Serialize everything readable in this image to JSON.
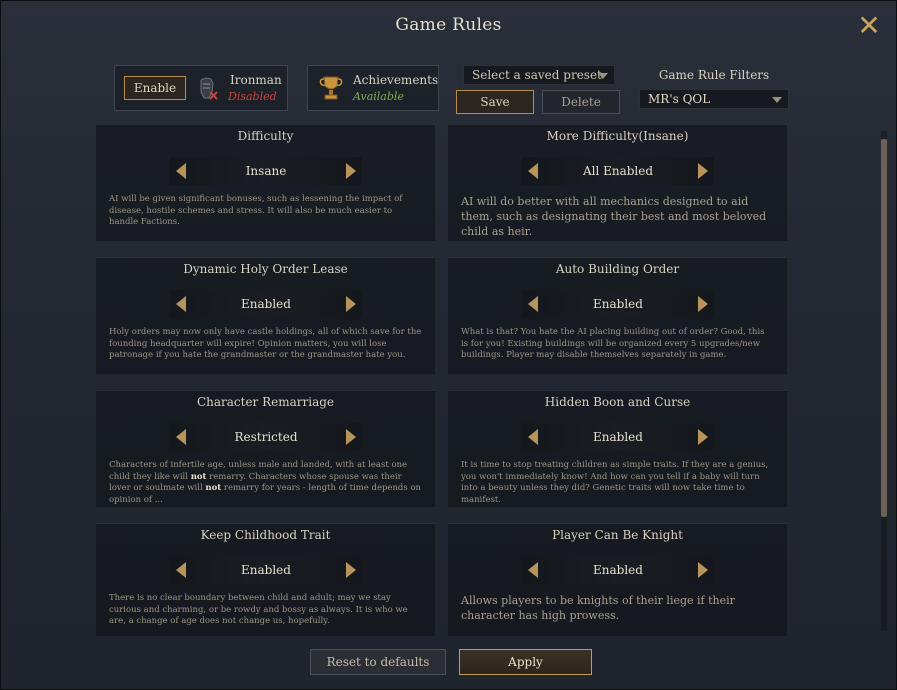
{
  "window": {
    "title": "Game Rules",
    "close_icon": "close-icon"
  },
  "ironman": {
    "enable_label": "Enable",
    "label": "Ironman",
    "status": "Disabled",
    "status_color": "#c9443a"
  },
  "achievements": {
    "label": "Achievements",
    "status": "Available",
    "status_color": "#7fae4f"
  },
  "preset": {
    "placeholder": "Select a saved preset",
    "save_label": "Save",
    "delete_label": "Delete"
  },
  "filters": {
    "title": "Game Rule Filters",
    "selected": "MR's QOL"
  },
  "rules": [
    {
      "title": "Difficulty",
      "value": "Insane",
      "desc": "AI will be given significant bonuses, such as lessening the impact of disease, hostile schemes and stress. It will also be much easier to handle Factions."
    },
    {
      "title": "More Difficulty(Insane)",
      "value": "All Enabled",
      "desc": "AI will do better with all mechanics designed to aid them, such as designating their best and most beloved child as heir."
    },
    {
      "title": "Dynamic Holy Order Lease",
      "value": "Enabled",
      "desc": "Holy orders may now only have castle holdings, all of which save for the founding headquarter will expire! Opinion matters, you will lose patronage if you hate the grandmaster or the grandmaster hate you."
    },
    {
      "title": "Auto Building Order",
      "value": "Enabled",
      "desc": "What is that? You hate the AI placing building out of order? Good, this is for you! Existing buildings will be organized every 5 upgrades/new buildings. Player may disable themselves separately in game."
    },
    {
      "title": "Character Remarriage",
      "value": "Restricted",
      "desc_a": "Characters of infertile age, unless male and landed, with at least one child they like will ",
      "desc_not1": "not",
      "desc_b": " remarry. Characters whose spouse was their lover or soulmate will ",
      "desc_not2": "not",
      "desc_c": " remarry for years - length of time depends on opinion of ..."
    },
    {
      "title": "Hidden Boon and Curse",
      "value": "Enabled",
      "desc": "It is time to stop treating children as simple traits. If they are a genius, you won't immediately know! And how can you tell if a baby will turn into a beauty unless they did? Genetic traits will now take time to manifest."
    },
    {
      "title": "Keep Childhood Trait",
      "value": "Enabled",
      "desc": "There is no clear boundary between child and adult; may we stay curious and charming, or be rowdy and bossy as always. It is who we are, a change of age does not change us, hopefully."
    },
    {
      "title": "Player Can Be Knight",
      "value": "Enabled",
      "desc": "Allows players to be knights of their liege if their character has high prowess."
    }
  ],
  "footer": {
    "reset_label": "Reset to defaults",
    "apply_label": "Apply"
  },
  "colors": {
    "accent_gold": "#b8935a",
    "background": "#232832"
  }
}
